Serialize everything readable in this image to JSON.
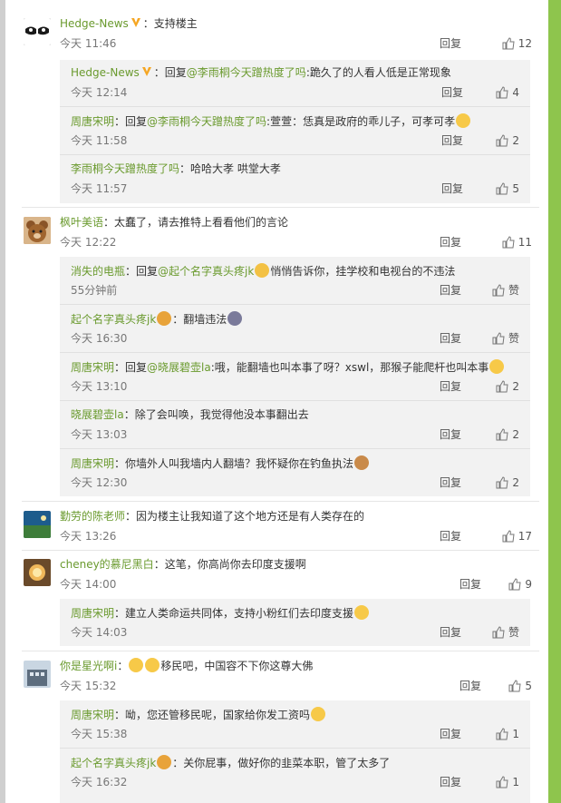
{
  "ui": {
    "reply": "回复",
    "like_icon": "thumbs-up-icon"
  },
  "c1": {
    "user": "Hedge-News",
    "text": "：支持楼主",
    "time": "今天 11:46",
    "likes": "12",
    "subs": [
      {
        "user": "Hedge-News",
        "pre": "：回复",
        "at": "@李雨桐今天蹭热度了吗",
        "post": ":跪久了的人看人低是正常现象",
        "time": "今天 12:14",
        "likes": "4"
      },
      {
        "user": "周唐宋明",
        "pre": "：回复",
        "at": "@李雨桐今天蹭热度了吗",
        "post": ":萱萱：恁真是政府的乖儿子，可孝可孝",
        "time": "今天 11:58",
        "likes": "2"
      },
      {
        "user": "李雨桐今天蹭热度了吗",
        "pre": "：哈哈大孝 哄堂大孝",
        "time": "今天 11:57",
        "likes": "5"
      }
    ]
  },
  "c2": {
    "user": "枫叶美语",
    "text": "：太蠢了，请去推特上看看他们的言论",
    "time": "今天 12:22",
    "likes": "11",
    "subs": [
      {
        "user": "消失的电瓶",
        "pre": "：回复",
        "at": "@起个名字真头疼jk",
        "post": "悄悄告诉你，挂学校和电视台的不违法",
        "time": "55分钟前",
        "likes": "赞"
      },
      {
        "user": "起个名字真头疼jk",
        "post": "：翻墙违法",
        "time": "今天 16:30",
        "likes": "赞"
      },
      {
        "user": "周唐宋明",
        "pre": "：回复",
        "at": "@晓展碧壶la",
        "post": ":哦，能翻墙也叫本事了呀？xswl，那猴子能爬杆也叫本事",
        "time": "今天 13:10",
        "likes": "2"
      },
      {
        "user": "晓展碧壶la",
        "post": "：除了会叫唤，我觉得他没本事翻出去",
        "time": "今天 13:03",
        "likes": "2"
      },
      {
        "user": "周唐宋明",
        "post": "：你墙外人叫我墙内人翻墙？我怀疑你在钓鱼执法",
        "time": "今天 12:30",
        "likes": "2"
      }
    ]
  },
  "c3": {
    "user": "勤劳的陈老师",
    "text": "：因为楼主让我知道了这个地方还是有人类存在的",
    "time": "今天 13:26",
    "likes": "17"
  },
  "c4": {
    "user": "cheney的慕尼黑白",
    "text": "：这笔，你高尚你去印度支援啊",
    "time": "今天 14:00",
    "likes": "9",
    "subs": [
      {
        "user": "周唐宋明",
        "post": "：建立人类命运共同体，支持小粉红们去印度支援",
        "time": "今天 14:03",
        "likes": "赞"
      }
    ]
  },
  "c5": {
    "user": "你是星光啊i",
    "text": "移民吧，中国容不下你这尊大佛",
    "time": "今天 15:32",
    "likes": "5",
    "subs": [
      {
        "user": "周唐宋明",
        "post": "：呦，您还管移民呢，国家给你发工资吗",
        "time": "今天 15:38",
        "likes": "1"
      },
      {
        "user": "起个名字真头疼jk",
        "post": "：关你屁事，做好你的韭菜本职，管了太多了",
        "time": "今天 16:32",
        "likes": "1"
      }
    ]
  },
  "colors": {
    "name": "#6a9a2e",
    "panel": "#ffffff",
    "sub_bg": "#f2f2f2",
    "accent_right": "#8ec54d"
  }
}
